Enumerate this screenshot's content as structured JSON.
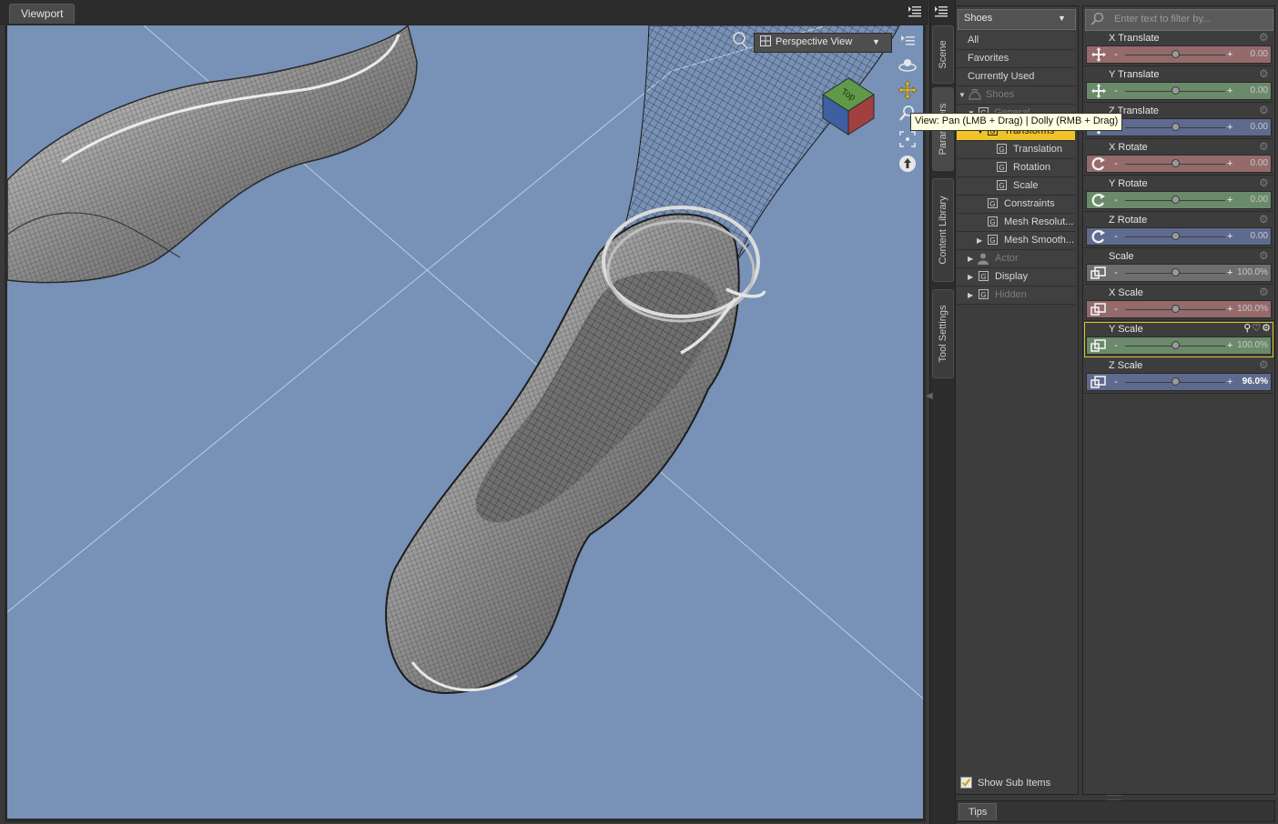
{
  "viewport": {
    "tab_label": "Viewport",
    "view_title": "Perspective View",
    "tooltip": "View: Pan (LMB + Drag) | Dolly (RMB + Drag)",
    "nav_cube_label": "Top",
    "background_color": "#7791b7"
  },
  "side_tabs": [
    "Scene",
    "Parameters",
    "Content Library",
    "Tool Settings"
  ],
  "parameters": {
    "node_selector": "Shoes",
    "filter_placeholder": "Enter text to filter by...",
    "tree": [
      {
        "label": "All"
      },
      {
        "label": "Favorites"
      },
      {
        "label": "Currently Used"
      },
      {
        "label": "Shoes"
      },
      {
        "label": "General"
      },
      {
        "label": "Transforms"
      },
      {
        "label": "Translation"
      },
      {
        "label": "Rotation"
      },
      {
        "label": "Scale"
      },
      {
        "label": "Constraints"
      },
      {
        "label": "Mesh Resolut..."
      },
      {
        "label": "Mesh Smooth..."
      },
      {
        "label": "Actor"
      },
      {
        "label": "Display"
      },
      {
        "label": "Hidden"
      }
    ],
    "show_sub_items": {
      "label": "Show Sub Items",
      "checked": true
    },
    "sliders": [
      {
        "name": "X Translate",
        "value": "0.00",
        "fraction": 0.5,
        "color": "red"
      },
      {
        "name": "Y Translate",
        "value": "0.00",
        "fraction": 0.5,
        "color": "green"
      },
      {
        "name": "Z Translate",
        "value": "0.00",
        "fraction": 0.5,
        "color": "blue"
      },
      {
        "name": "X Rotate",
        "value": "0.00",
        "fraction": 0.5,
        "color": "red"
      },
      {
        "name": "Y Rotate",
        "value": "0.00",
        "fraction": 0.5,
        "color": "green"
      },
      {
        "name": "Z Rotate",
        "value": "0.00",
        "fraction": 0.5,
        "color": "blue"
      },
      {
        "name": "Scale",
        "value": "100.0%",
        "fraction": 0.5,
        "color": "gray"
      },
      {
        "name": "X Scale",
        "value": "100.0%",
        "fraction": 0.5,
        "color": "red"
      },
      {
        "name": "Y Scale",
        "value": "100.0%",
        "fraction": 0.5,
        "color": "green"
      },
      {
        "name": "Z Scale",
        "value": "96.0%",
        "fraction": 0.5,
        "color": "blue"
      }
    ]
  },
  "tips": {
    "tab_label": "Tips"
  },
  "colors": {
    "selection": "#f0c429",
    "highlight_outline": "#e2c12a"
  }
}
